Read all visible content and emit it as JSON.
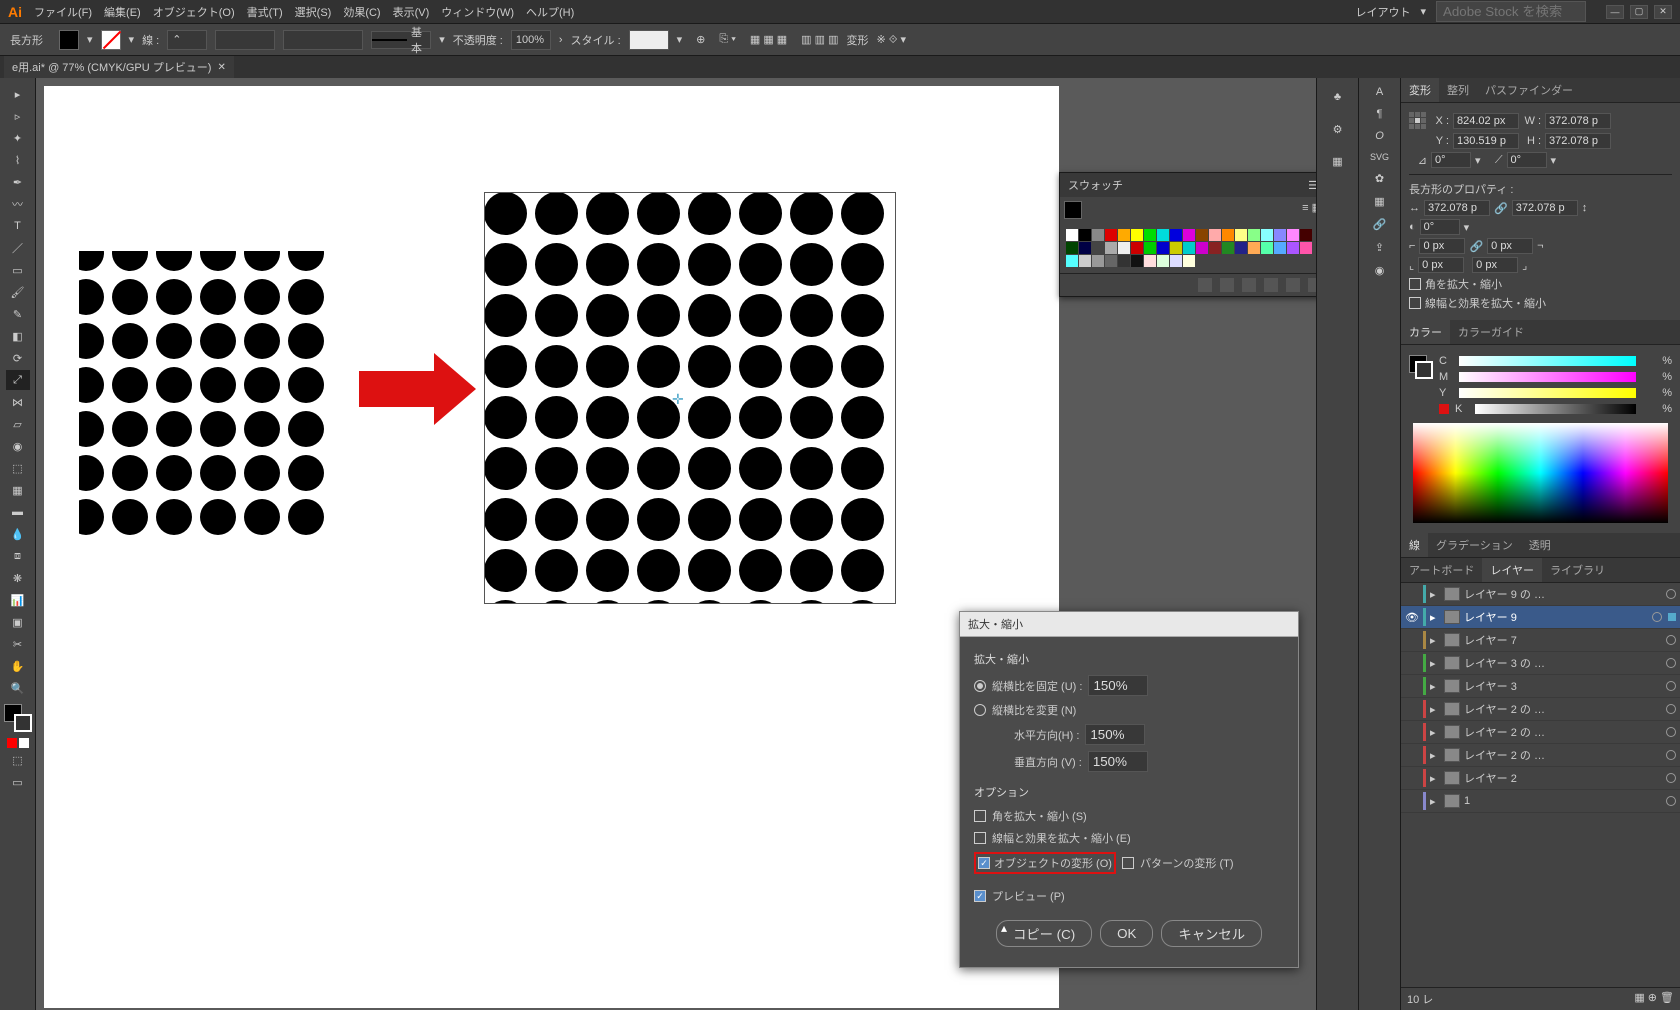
{
  "menubar": {
    "items": [
      "ファイル(F)",
      "編集(E)",
      "オブジェクト(O)",
      "書式(T)",
      "選択(S)",
      "効果(C)",
      "表示(V)",
      "ウィンドウ(W)",
      "ヘルプ(H)"
    ],
    "layout_label": "レイアウト",
    "stock_placeholder": "Adobe Stock を検索"
  },
  "controlbar": {
    "shape": "長方形",
    "stroke_label": "線 :",
    "stroke_style": "基本",
    "opacity_label": "不透明度 :",
    "opacity_value": "100%",
    "style_label": "スタイル :",
    "transform_label": "変形"
  },
  "doctab": {
    "title": "e用.ai* @ 77% (CMYK/GPU プレビュー)"
  },
  "swatches": {
    "title": "スウォッチ"
  },
  "dialog": {
    "title": "拡大・縮小",
    "section1": "拡大・縮小",
    "uniform_label": "縦横比を固定 (U) :",
    "uniform_value": "150%",
    "nonuniform_label": "縦横比を変更 (N)",
    "h_label": "水平方向(H) :",
    "h_value": "150%",
    "v_label": "垂直方向 (V) :",
    "v_value": "150%",
    "options_label": "オプション",
    "scale_corners": "角を拡大・縮小 (S)",
    "scale_strokes": "線幅と効果を拡大・縮小 (E)",
    "transform_objects": "オブジェクトの変形 (O)",
    "transform_patterns": "パターンの変形 (T)",
    "preview": "プレビュー (P)",
    "copy_btn": "コピー (C)",
    "ok_btn": "OK",
    "cancel_btn": "キャンセル"
  },
  "transform": {
    "tabs": [
      "変形",
      "整列",
      "パスファインダー"
    ],
    "x": "824.02 px",
    "w": "372.078 p",
    "y": "130.519 p",
    "h": "372.078 p",
    "angle1": "0°",
    "angle2": "0°",
    "rect_props": "長方形のプロパティ :",
    "rw": "372.078 p",
    "rh": "372.078 p",
    "rangle": "0°",
    "corner": "0 px",
    "cb1": "角を拡大・縮小",
    "cb2": "線幅と効果を拡大・縮小"
  },
  "color": {
    "tabs": [
      "カラー",
      "カラーガイド"
    ],
    "channels": [
      "C",
      "M",
      "Y",
      "K"
    ]
  },
  "stroke_tabs": [
    "線",
    "グラデーション",
    "透明"
  ],
  "layer_tabs": [
    "アートボード",
    "レイヤー",
    "ライブラリ"
  ],
  "layers": [
    {
      "name": "レイヤー 9 の …",
      "color": "#4aa",
      "selected": false,
      "visible": false
    },
    {
      "name": "レイヤー 9",
      "color": "#4aa",
      "selected": true,
      "visible": true
    },
    {
      "name": "レイヤー 7",
      "color": "#a84",
      "selected": false,
      "visible": false
    },
    {
      "name": "レイヤー 3 の …",
      "color": "#4a4",
      "selected": false,
      "visible": false
    },
    {
      "name": "レイヤー 3",
      "color": "#4a4",
      "selected": false,
      "visible": false
    },
    {
      "name": "レイヤー 2 の …",
      "color": "#c44",
      "selected": false,
      "visible": false
    },
    {
      "name": "レイヤー 2 の …",
      "color": "#c44",
      "selected": false,
      "visible": false
    },
    {
      "name": "レイヤー 2 の …",
      "color": "#c44",
      "selected": false,
      "visible": false
    },
    {
      "name": "レイヤー 2",
      "color": "#c44",
      "selected": false,
      "visible": false
    },
    {
      "name": "1",
      "color": "#88c",
      "selected": false,
      "visible": false
    }
  ],
  "status": {
    "layer_count": "10 レ"
  }
}
